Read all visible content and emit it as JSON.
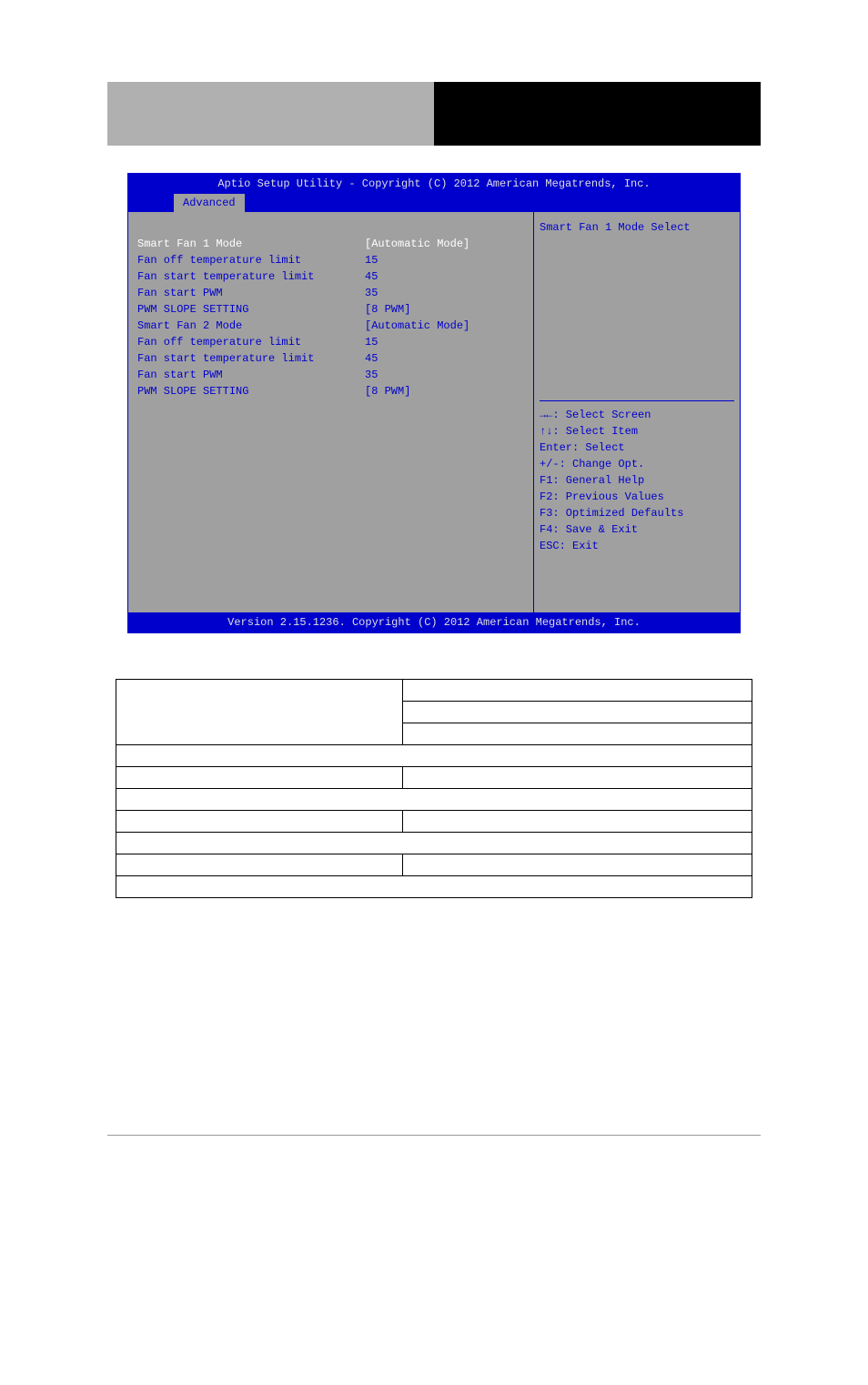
{
  "bios": {
    "header": "Aptio Setup Utility - Copyright (C) 2012 American Megatrends, Inc.",
    "tab": "Advanced",
    "footer": "Version 2.15.1236. Copyright (C) 2012 American Megatrends, Inc.",
    "rows": [
      {
        "label": "Smart Fan 1 Mode",
        "value": "[Automatic Mode]",
        "selected": true
      },
      {
        "label": "Fan off temperature limit",
        "value": "15",
        "selected": false
      },
      {
        "label": "Fan start temperature limit",
        "value": "45",
        "selected": false
      },
      {
        "label": "Fan start PWM",
        "value": "35",
        "selected": false
      },
      {
        "label": "PWM SLOPE SETTING",
        "value": "[8 PWM]",
        "selected": false
      },
      {
        "label": "Smart Fan 2 Mode",
        "value": "[Automatic Mode]",
        "selected": false
      },
      {
        "label": "Fan off temperature limit",
        "value": "15",
        "selected": false
      },
      {
        "label": "Fan start temperature limit",
        "value": "45",
        "selected": false
      },
      {
        "label": "Fan start PWM",
        "value": "35",
        "selected": false
      },
      {
        "label": "PWM SLOPE SETTING",
        "value": "[8 PWM]",
        "selected": false
      }
    ],
    "help_title": "Smart Fan 1 Mode Select",
    "help_keys": [
      "→←: Select Screen",
      "↑↓: Select Item",
      "Enter: Select",
      "+/-: Change Opt.",
      "F1: General Help",
      "F2: Previous Values",
      "F3: Optimized Defaults",
      "F4: Save & Exit",
      "ESC: Exit"
    ]
  }
}
